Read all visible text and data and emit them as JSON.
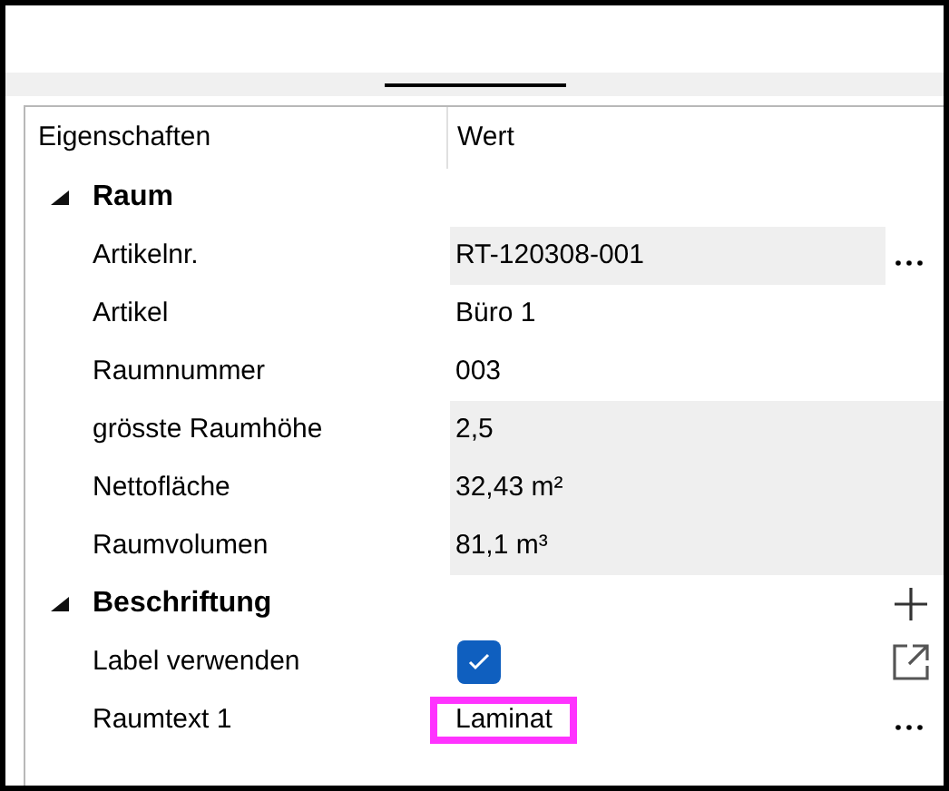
{
  "columns": [
    "Eigenschaften",
    "Wert"
  ],
  "groups": [
    {
      "label": "Raum",
      "expanded": true,
      "rows": [
        {
          "kind": "text",
          "label": "Artikelnr.",
          "value": "RT-120308-001",
          "readonly": true,
          "action": {
            "kind": "more"
          },
          "highlighted": false
        },
        {
          "kind": "text",
          "label": "Artikel",
          "value": "Büro 1",
          "readonly": false,
          "highlighted": false
        },
        {
          "kind": "text",
          "label": "Raumnummer",
          "value": "003",
          "readonly": false,
          "highlighted": false
        },
        {
          "kind": "text",
          "label": "grösste Raumhöhe",
          "value": "2,5",
          "readonly": true,
          "highlighted": false
        },
        {
          "kind": "text",
          "label": "Nettofläche",
          "value": "32,43 m²",
          "readonly": true,
          "highlighted": false
        },
        {
          "kind": "text",
          "label": "Raumvolumen",
          "value": "81,1 m³",
          "readonly": true,
          "highlighted": false
        }
      ]
    },
    {
      "label": "Beschriftung",
      "expanded": true,
      "action": {
        "kind": "add"
      },
      "rows": [
        {
          "kind": "checkbox",
          "label": "Label verwenden",
          "checked": true,
          "action": {
            "kind": "open"
          }
        },
        {
          "kind": "text",
          "label": "Raumtext 1",
          "value": "Laminat",
          "readonly": false,
          "action": {
            "kind": "more"
          },
          "highlighted": true
        }
      ]
    }
  ]
}
